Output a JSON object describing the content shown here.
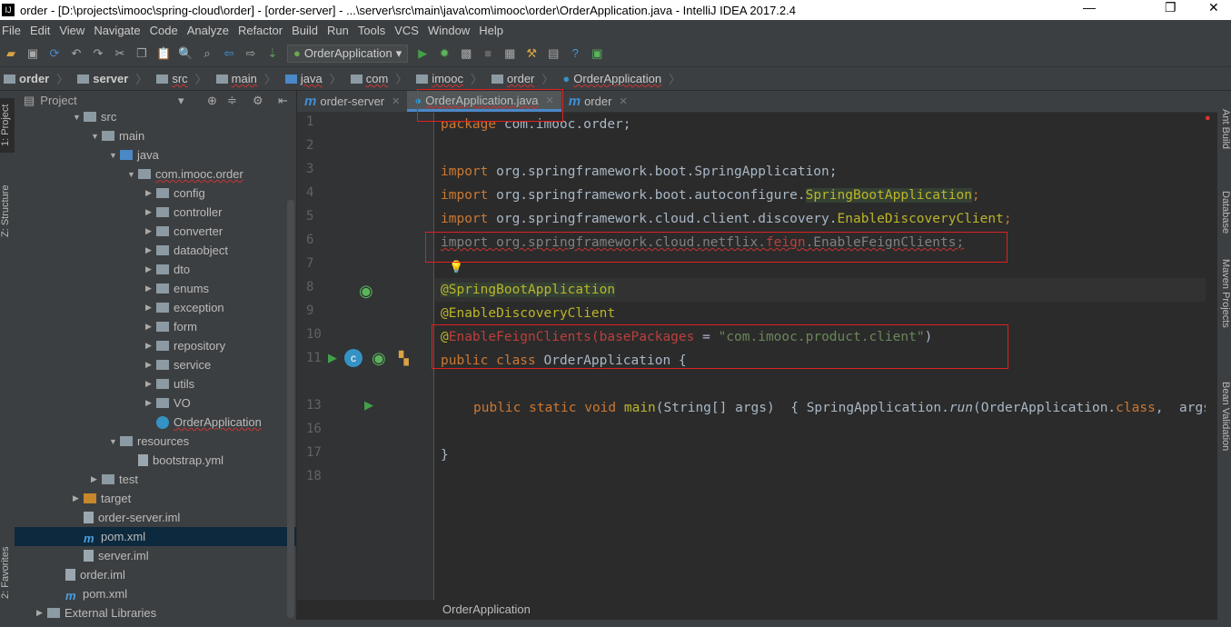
{
  "window": {
    "title": "order - [D:\\projects\\imooc\\spring-cloud\\order] - [order-server] - ...\\server\\src\\main\\java\\com\\imooc\\order\\OrderApplication.java - IntelliJ IDEA 2017.2.4",
    "minimize": "—",
    "maximize": "❐",
    "close": "✕"
  },
  "menu": [
    "File",
    "Edit",
    "View",
    "Navigate",
    "Code",
    "Analyze",
    "Refactor",
    "Build",
    "Run",
    "Tools",
    "VCS",
    "Window",
    "Help"
  ],
  "toolbar": {
    "run_config": "OrderApplication"
  },
  "breadcrumbs": [
    "order",
    "server",
    "src",
    "main",
    "java",
    "com",
    "imooc",
    "order",
    "OrderApplication"
  ],
  "left_tool_tabs": [
    "1: Project",
    "Z: Structure",
    "2: Favorites"
  ],
  "project_panel": {
    "title": "Project",
    "tree": [
      {
        "label": "src",
        "depth": 2,
        "type": "folder",
        "expanded": true
      },
      {
        "label": "main",
        "depth": 3,
        "type": "folder",
        "expanded": true
      },
      {
        "label": "java",
        "depth": 4,
        "type": "folder-blue",
        "expanded": true
      },
      {
        "label": "com.imooc.order",
        "depth": 5,
        "type": "package",
        "expanded": true,
        "error": true
      },
      {
        "label": "config",
        "depth": 6,
        "type": "package",
        "expanded": false
      },
      {
        "label": "controller",
        "depth": 6,
        "type": "package",
        "expanded": false
      },
      {
        "label": "converter",
        "depth": 6,
        "type": "package",
        "expanded": false
      },
      {
        "label": "dataobject",
        "depth": 6,
        "type": "package",
        "expanded": false
      },
      {
        "label": "dto",
        "depth": 6,
        "type": "package",
        "expanded": false
      },
      {
        "label": "enums",
        "depth": 6,
        "type": "package",
        "expanded": false
      },
      {
        "label": "exception",
        "depth": 6,
        "type": "package",
        "expanded": false
      },
      {
        "label": "form",
        "depth": 6,
        "type": "package",
        "expanded": false
      },
      {
        "label": "repository",
        "depth": 6,
        "type": "package",
        "expanded": false
      },
      {
        "label": "service",
        "depth": 6,
        "type": "package",
        "expanded": false
      },
      {
        "label": "utils",
        "depth": 6,
        "type": "package",
        "expanded": false
      },
      {
        "label": "VO",
        "depth": 6,
        "type": "package",
        "expanded": false
      },
      {
        "label": "OrderApplication",
        "depth": 6,
        "type": "class",
        "error": true
      },
      {
        "label": "resources",
        "depth": 4,
        "type": "folder",
        "expanded": true
      },
      {
        "label": "bootstrap.yml",
        "depth": 5,
        "type": "file"
      },
      {
        "label": "test",
        "depth": 3,
        "type": "folder",
        "expanded": false
      },
      {
        "label": "target",
        "depth": 2,
        "type": "folder-orange",
        "expanded": false
      },
      {
        "label": "order-server.iml",
        "depth": 2,
        "type": "file"
      },
      {
        "label": "pom.xml",
        "depth": 2,
        "type": "maven",
        "selected": true
      },
      {
        "label": "server.iml",
        "depth": 2,
        "type": "file"
      },
      {
        "label": "order.iml",
        "depth": 1,
        "type": "file"
      },
      {
        "label": "pom.xml",
        "depth": 1,
        "type": "maven"
      },
      {
        "label": "External Libraries",
        "depth": 0,
        "type": "lib",
        "expanded": false
      }
    ]
  },
  "tabs": [
    {
      "label": "order-server",
      "icon": "maven-icon"
    },
    {
      "label": "OrderApplication.java",
      "icon": "spring-class-icon",
      "active": true
    },
    {
      "label": "order",
      "icon": "maven-icon"
    }
  ],
  "editor": {
    "line_numbers": [
      "1",
      "2",
      "3",
      "4",
      "5",
      "6",
      "7",
      "8",
      "9",
      "10",
      "11",
      "13",
      "16",
      "17",
      "18"
    ],
    "code": {
      "l1": [
        "package",
        " com.imooc.order;"
      ],
      "l3": [
        "import",
        " org.springframework.boot.SpringApplication;"
      ],
      "l4": [
        "import",
        " org.springframework.boot.autoconfigure.",
        "SpringBootApplication",
        ";"
      ],
      "l5": [
        "import",
        " org.springframework.cloud.client.discovery.",
        "EnableDiscoveryClient",
        ";"
      ],
      "l6": [
        "import org.springframework.cloud.netflix.",
        "feign",
        ".EnableFeignClients;"
      ],
      "l8": "@SpringBootApplication",
      "l9": "@EnableDiscoveryClient",
      "l10": [
        "@",
        "EnableFeignClients",
        "(basePackages",
        " = ",
        "\"com.imooc.product.client\"",
        ")"
      ],
      "l11": [
        "public class",
        " OrderApplication {"
      ],
      "l13": [
        "public static void",
        " main",
        "(String[] args) ",
        " { ",
        "SpringApplication.",
        "run",
        "(OrderApplication.",
        "class",
        ",  args"
      ],
      "l17": "}"
    },
    "breadcrumb_footer": "OrderApplication"
  },
  "right_tool_tabs": [
    "Ant Build",
    "Database",
    "Maven Projects",
    "Bean Validation"
  ]
}
